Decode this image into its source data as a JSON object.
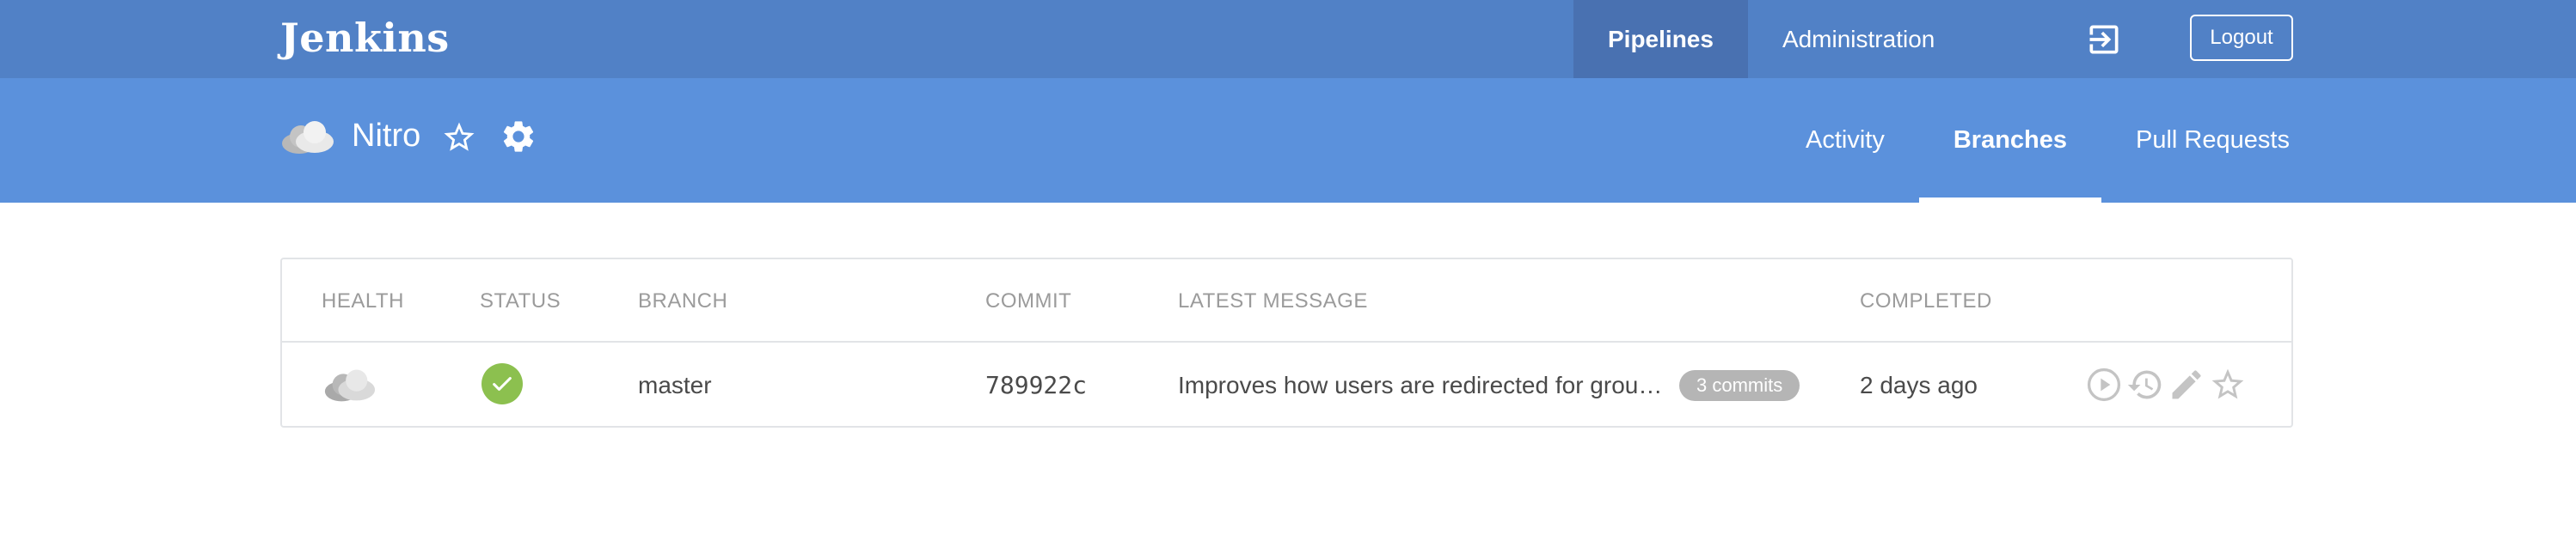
{
  "header": {
    "logo": "Jenkins",
    "nav": [
      {
        "label": "Pipelines",
        "active": true
      },
      {
        "label": "Administration",
        "active": false
      }
    ],
    "login_icon": "exit-to-app-icon",
    "logout_label": "Logout"
  },
  "pipeline": {
    "health_icon": "cloudy-weather-icon",
    "name": "Nitro",
    "favorite_icon": "star-outline-icon",
    "settings_icon": "gear-icon",
    "tabs": [
      {
        "label": "Activity",
        "active": false
      },
      {
        "label": "Branches",
        "active": true
      },
      {
        "label": "Pull Requests",
        "active": false
      }
    ]
  },
  "table": {
    "columns": [
      "HEALTH",
      "STATUS",
      "BRANCH",
      "COMMIT",
      "LATEST MESSAGE",
      "COMPLETED"
    ],
    "rows": [
      {
        "health_icon": "cloudy-weather-icon",
        "status": "success",
        "status_icon": "check-icon",
        "branch": "master",
        "commit": "789922c",
        "message": "Improves how users are redirected for group management actions",
        "commits_badge": "3 commits",
        "completed": "2 days ago",
        "actions": [
          "play-icon",
          "history-icon",
          "pencil-icon",
          "star-outline-icon"
        ]
      }
    ]
  },
  "colors": {
    "topbar": "#5181c6",
    "topbar_active": "#4971b1",
    "subbar": "#5b91dc",
    "success": "#8cc04f",
    "badge": "#b5b5b5"
  }
}
